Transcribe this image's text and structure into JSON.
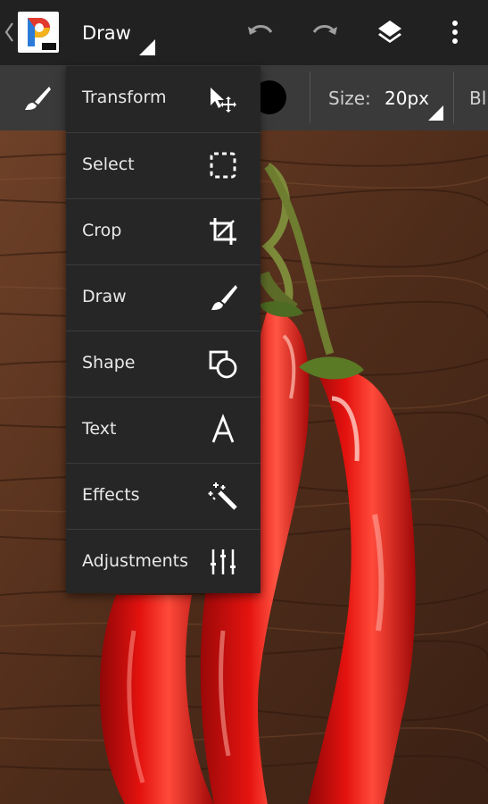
{
  "app": {
    "logo_name": "photoshop-pro-logo",
    "mode_label": "Draw"
  },
  "toolbar": {
    "undo_icon": "undo-icon",
    "redo_icon": "redo-icon",
    "layers_icon": "layers-icon",
    "overflow_icon": "more-vert-icon"
  },
  "tool_options": {
    "size_label": "Size:",
    "size_value": "20px",
    "next_label": "Bl",
    "color": "#000000"
  },
  "menu": {
    "items": [
      {
        "label": "Transform",
        "icon": "transform-icon"
      },
      {
        "label": "Select",
        "icon": "select-icon"
      },
      {
        "label": "Crop",
        "icon": "crop-icon"
      },
      {
        "label": "Draw",
        "icon": "brush-icon"
      },
      {
        "label": "Shape",
        "icon": "shape-icon"
      },
      {
        "label": "Text",
        "icon": "text-icon"
      },
      {
        "label": "Effects",
        "icon": "effects-icon"
      },
      {
        "label": "Adjustments",
        "icon": "adjustments-icon"
      }
    ]
  },
  "colors": {
    "appbar": "#212121",
    "toolbar": "#3a3a3a",
    "menu": "#262626",
    "wood": "#6b3f25",
    "pepper": "#d8100f"
  }
}
